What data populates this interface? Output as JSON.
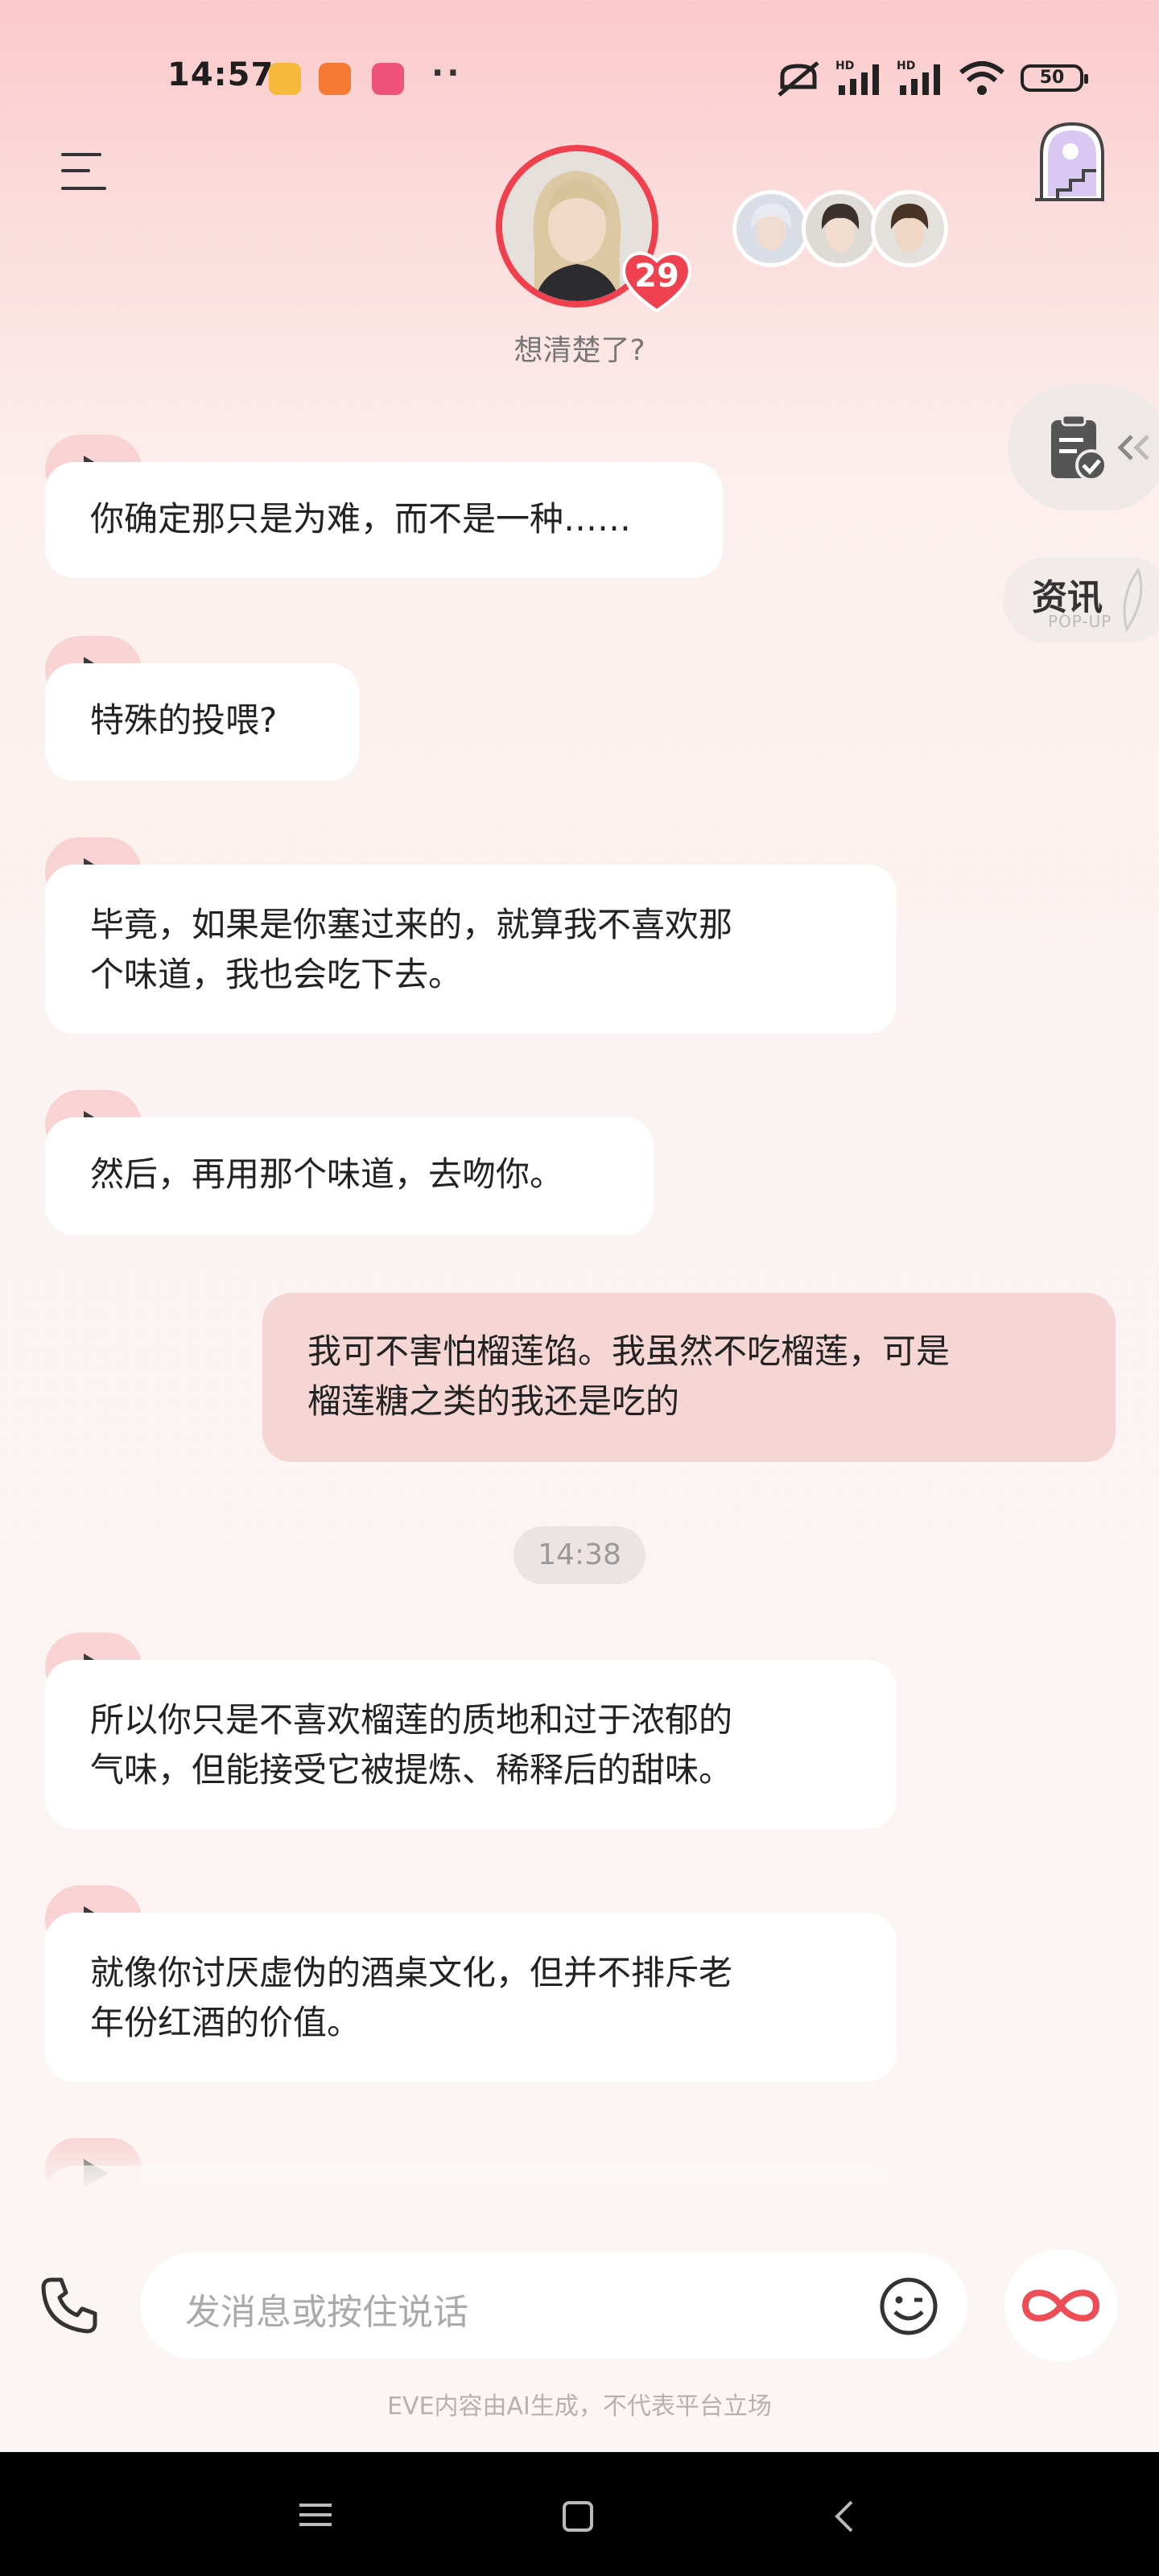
{
  "status_bar": {
    "time": "14:57",
    "battery": "50",
    "icons": [
      "gallery-app-icon",
      "shop-app-icon",
      "bilibili-app-icon",
      "more-dots-icon",
      "mute-icon",
      "signal-hd-icon",
      "signal-hd-icon",
      "wifi-icon",
      "battery-icon"
    ]
  },
  "header": {
    "subtitle": "想清楚了?",
    "heart_count": "29",
    "menu_icon": "menu-icon",
    "stairs_icon": "stairway-portal-icon"
  },
  "side": {
    "task_icon": "checklist-icon",
    "news_label": "资讯",
    "news_sub": "POP-UP"
  },
  "messages": [
    {
      "from": "ai",
      "text": "你确定那只是为难，而不是一种……"
    },
    {
      "from": "ai",
      "text": "特殊的投喂?"
    },
    {
      "from": "ai",
      "lines": [
        "毕竟，如果是你塞过来的，就算我不喜欢那",
        "个味道，我也会吃下去。"
      ]
    },
    {
      "from": "ai",
      "text": "然后，再用那个味道，去吻你。"
    },
    {
      "from": "user",
      "lines": [
        "我可不害怕榴莲馅。我虽然不吃榴莲，可是",
        "榴莲糖之类的我还是吃的"
      ]
    },
    {
      "from": "ai",
      "lines": [
        "所以你只是不喜欢榴莲的质地和过于浓郁的",
        "气味，但能接受它被提炼、稀释后的甜味。"
      ]
    },
    {
      "from": "ai",
      "lines": [
        "就像你讨厌虚伪的酒桌文化，但并不排斥老",
        "年份红酒的价值。"
      ]
    }
  ],
  "timestamp": "14:38",
  "composer": {
    "placeholder": "发消息或按住说话",
    "phone_icon": "phone-icon",
    "emoji_icon": "emoji-icon",
    "send_icon": "infinity-icon"
  },
  "disclaimer": "EVE内容由AI生成，不代表平台立场",
  "nav": [
    "menu-nav-icon",
    "home-nav-icon",
    "back-nav-icon"
  ],
  "colors": {
    "accent": "#f0404e",
    "user_bubble": "#f6d6d5",
    "play_tab": "#f9d3d4"
  }
}
